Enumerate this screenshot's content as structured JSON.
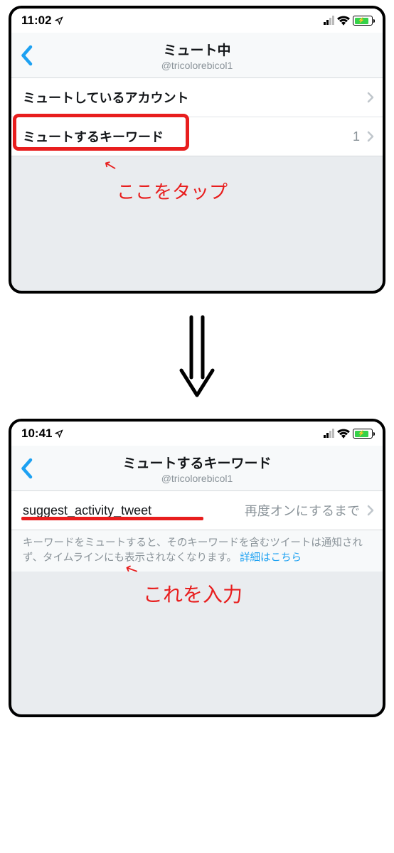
{
  "screen1": {
    "status": {
      "time": "11:02"
    },
    "nav": {
      "title": "ミュート中",
      "subtitle": "@tricolorebicol1"
    },
    "rows": [
      {
        "label": "ミュートしているアカウント",
        "value": ""
      },
      {
        "label": "ミュートするキーワード",
        "value": "1"
      }
    ],
    "annotation": {
      "arrow": "↖",
      "text": "ここをタップ"
    }
  },
  "screen2": {
    "status": {
      "time": "10:41"
    },
    "nav": {
      "title": "ミュートするキーワード",
      "subtitle": "@tricolorebicol1"
    },
    "row": {
      "label": "suggest_activity_tweet",
      "value": "再度オンにするまで"
    },
    "help": {
      "text": "キーワードをミュートすると、そのキーワードを含むツイートは通知されず、タイムラインにも表示されなくなります。",
      "link": "詳細はこちら"
    },
    "annotation": {
      "arrow": "↖",
      "text": "これを入力"
    }
  }
}
